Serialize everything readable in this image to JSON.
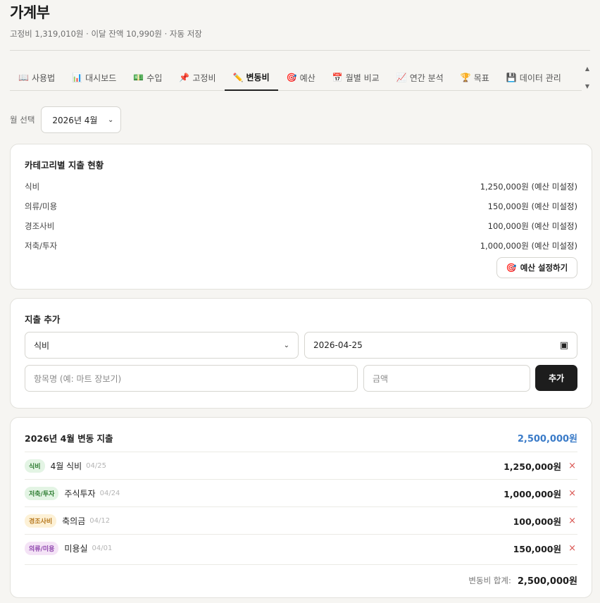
{
  "app": {
    "title": "가계부",
    "subtitle": "고정비 1,319,010원 · 이달 잔액 10,990원 · 자동 저장"
  },
  "tabs": [
    {
      "icon": "book-icon",
      "glyph": "📖",
      "label": "사용법"
    },
    {
      "icon": "bar-chart-icon",
      "glyph": "📊",
      "label": "대시보드"
    },
    {
      "icon": "money-icon",
      "glyph": "💵",
      "label": "수입"
    },
    {
      "icon": "pushpin-icon",
      "glyph": "📌",
      "label": "고정비"
    },
    {
      "icon": "pencil-icon",
      "glyph": "✏️",
      "label": "변동비",
      "active": true
    },
    {
      "icon": "target-icon",
      "glyph": "🎯",
      "label": "예산"
    },
    {
      "icon": "calendar-icon",
      "glyph": "📅",
      "label": "월별 비교"
    },
    {
      "icon": "trend-chart-icon",
      "glyph": "📈",
      "label": "연간 분석"
    },
    {
      "icon": "trophy-icon",
      "glyph": "🏆",
      "label": "목표"
    },
    {
      "icon": "floppy-disk-icon",
      "glyph": "💾",
      "label": "데이터 관리"
    }
  ],
  "month": {
    "label": "월 선택",
    "selected": "2026년 4월"
  },
  "category_status": {
    "title": "카테고리별 지출 현황",
    "rows": [
      {
        "name": "식비",
        "value": "1,250,000원 (예산 미설정)"
      },
      {
        "name": "의류/미용",
        "value": "150,000원 (예산 미설정)"
      },
      {
        "name": "경조사비",
        "value": "100,000원 (예산 미설정)"
      },
      {
        "name": "저축/투자",
        "value": "1,000,000원 (예산 미설정)"
      }
    ],
    "budget_button": "예산 설정하기"
  },
  "add_expense": {
    "title": "지출 추가",
    "category": "식비",
    "date": "2026-04-25",
    "item_placeholder": "항목명 (예: 마트 장보기)",
    "amount_placeholder": "금액",
    "add_button": "추가"
  },
  "expense_list": {
    "title": "2026년 4월 변동 지출",
    "total": "2,500,000원",
    "items": [
      {
        "category": "식비",
        "name": "4월 식비",
        "date": "04/25",
        "amount": "1,250,000원",
        "delete": "×"
      },
      {
        "category": "저축/투자",
        "name": "주식투자",
        "date": "04/24",
        "amount": "1,000,000원",
        "delete": "×"
      },
      {
        "category": "경조사비",
        "name": "축의금",
        "date": "04/12",
        "amount": "100,000원",
        "delete": "×"
      },
      {
        "category": "의류/미용",
        "name": "미용실",
        "date": "04/01",
        "amount": "150,000원",
        "delete": "×"
      }
    ],
    "sum_label": "변동비 합계:",
    "sum_value": "2,500,000원"
  },
  "colors": {
    "accent_blue": "#3a7bc8",
    "delete_red": "#d9534f",
    "badge_food": "#e3f4e4",
    "badge_saving": "#e3f4e4",
    "badge_event": "#fdf1d6",
    "badge_beauty": "#f4e3f6"
  }
}
